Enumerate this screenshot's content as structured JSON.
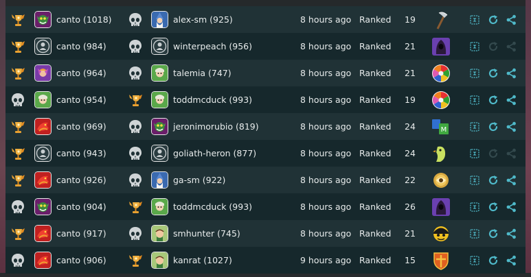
{
  "table": {
    "rows": [
      {
        "result1": "trophy",
        "avatar1": "goblin-avatar",
        "player1": "canto (1018)",
        "result2": "skull",
        "avatar2": "wizard-avatar",
        "player2": "alex-sm (925)",
        "time": "8 hours ago",
        "type": "Ranked",
        "turns": "19",
        "game": "axe-icon",
        "actions_enabled": true
      },
      {
        "result1": "trophy",
        "avatar1": "default-avatar",
        "player1": "canto (984)",
        "result2": "skull",
        "avatar2": "default-avatar",
        "player2": "winterpeach (956)",
        "time": "8 hours ago",
        "type": "Ranked",
        "turns": "21",
        "game": "hooded-figure-icon",
        "actions_enabled": false
      },
      {
        "result1": "trophy",
        "avatar1": "purple-elf-avatar",
        "player1": "canto (964)",
        "result2": "skull",
        "avatar2": "elf-avatar",
        "player2": "talemia (747)",
        "time": "8 hours ago",
        "type": "Ranked",
        "turns": "21",
        "game": "trivia-wheel-icon",
        "actions_enabled": true
      },
      {
        "result1": "skull",
        "avatar1": "elf-avatar",
        "player1": "canto (954)",
        "result2": "trophy",
        "avatar2": "elf-avatar",
        "player2": "toddmcduck (993)",
        "time": "8 hours ago",
        "type": "Ranked",
        "turns": "19",
        "game": "trivia-wheel-icon",
        "actions_enabled": true
      },
      {
        "result1": "trophy",
        "avatar1": "dragon-avatar",
        "player1": "canto (969)",
        "result2": "skull",
        "avatar2": "goblin-avatar",
        "player2": "jeronimorubio (819)",
        "time": "8 hours ago",
        "type": "Ranked",
        "turns": "24",
        "game": "letter-tiles-icon",
        "actions_enabled": true
      },
      {
        "result1": "trophy",
        "avatar1": "default-avatar",
        "player1": "canto (943)",
        "result2": "skull",
        "avatar2": "default-avatar",
        "player2": "goliath-heron (877)",
        "time": "8 hours ago",
        "type": "Ranked",
        "turns": "24",
        "game": "bird-icon",
        "actions_enabled": false
      },
      {
        "result1": "trophy",
        "avatar1": "dragon-avatar",
        "player1": "canto (926)",
        "result2": "skull",
        "avatar2": "wizard-avatar",
        "player2": "ga-sm (922)",
        "time": "8 hours ago",
        "type": "Ranked",
        "turns": "22",
        "game": "eye-icon",
        "actions_enabled": true
      },
      {
        "result1": "skull",
        "avatar1": "goblin-avatar",
        "player1": "canto (904)",
        "result2": "trophy",
        "avatar2": "elf-avatar",
        "player2": "toddmcduck (993)",
        "time": "8 hours ago",
        "type": "Ranked",
        "turns": "26",
        "game": "hooded-figure-icon",
        "actions_enabled": true
      },
      {
        "result1": "trophy",
        "avatar1": "dragon-avatar",
        "player1": "canto (917)",
        "result2": "skull",
        "avatar2": "hunter-avatar",
        "player2": "smhunter (745)",
        "time": "8 hours ago",
        "type": "Ranked",
        "turns": "21",
        "game": "yellow-face-icon",
        "actions_enabled": true
      },
      {
        "result1": "skull",
        "avatar1": "dragon-avatar",
        "player1": "canto (906)",
        "result2": "trophy",
        "avatar2": "hunter-avatar",
        "player2": "kanrat (1027)",
        "time": "9 hours ago",
        "type": "Ranked",
        "turns": "15",
        "game": "shield-icon",
        "actions_enabled": true
      }
    ]
  },
  "colors": {
    "row_dark": "#16282c",
    "row_light": "#203236",
    "text": "#e8ecec",
    "action_icon": "#4fb9c9",
    "action_icon_disabled": "#33494d",
    "trophy": "#e8a030",
    "skull": "#cfd4d6"
  }
}
